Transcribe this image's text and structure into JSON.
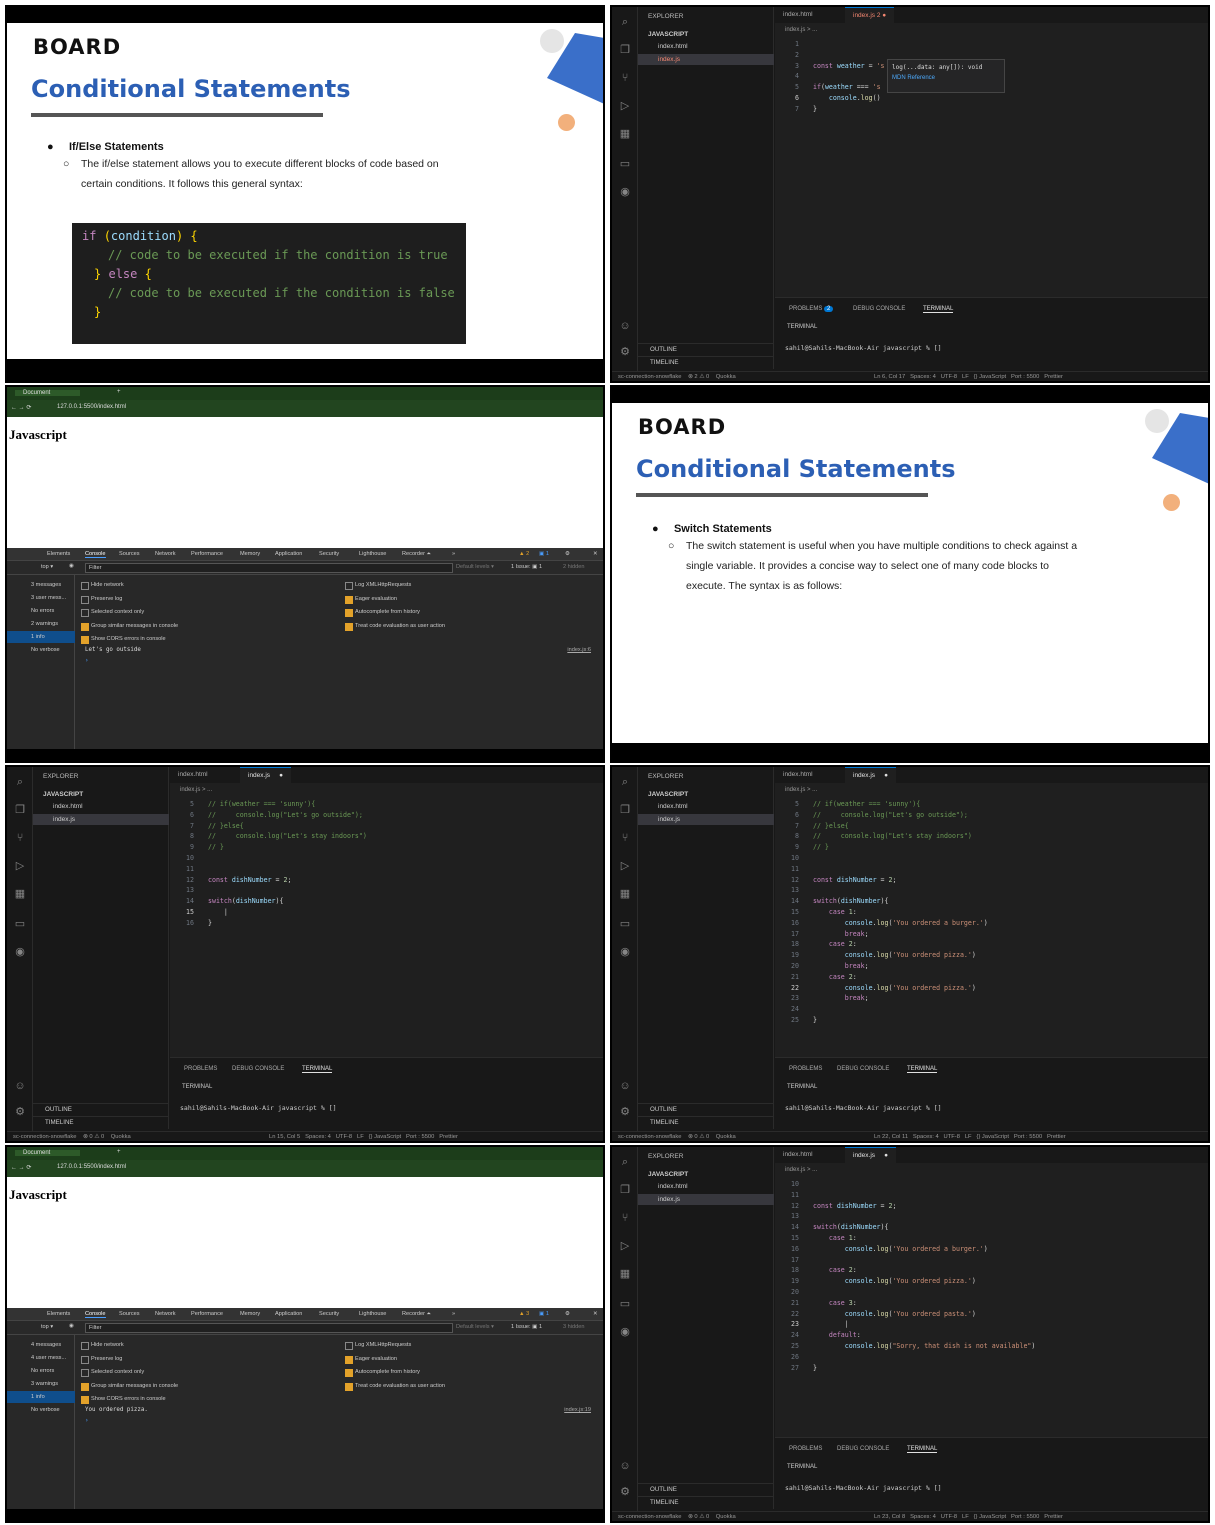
{
  "slide1": {
    "logo": "BOARD",
    "title": "Conditional Statements",
    "bullet": "If/Else Statements",
    "sub": "The if/else statement allows you to execute different blocks of code based on certain conditions. It follows this general syntax:",
    "code": [
      "if (condition) {",
      "    // code to be executed if the condition is true",
      "} else {",
      "    // code to be executed if the condition is false",
      "}"
    ]
  },
  "slide2": {
    "logo": "BOARD",
    "title": "Conditional Statements",
    "bullet": "Switch Statements",
    "sub": "The switch statement is useful when you have multiple conditions to check against a single variable. It provides a concise way to select one of many code blocks to execute. The syntax is as follows:"
  },
  "vs_common": {
    "explorer": "EXPLORER",
    "folder": "JAVASCRIPT",
    "file1": "index.html",
    "file2": "index.js",
    "tab1": "index.html",
    "tab2": "index.js",
    "crumb": "index.js > ...",
    "problems": "PROBLEMS",
    "debug": "DEBUG CONSOLE",
    "terminal": "TERMINAL",
    "terminal_hdr": "TERMINAL",
    "prompt": "sahil@Sahils-MacBook-Air javascript % []",
    "outline": "OUTLINE",
    "timeline": "TIMELINE",
    "branch": "sc-connection-snowflake",
    "quokka": "Quokka",
    "spaces": "Spaces: 4",
    "enc": "UTF-8",
    "eol": "LF",
    "lang": "{} JavaScript",
    "port": "Port : 5500",
    "prettier": "Prettier"
  },
  "vs1": {
    "tab_badge": "2",
    "problem_count": "2",
    "hover_sig": "log(...data: any[]): void",
    "hover_link": "MDN Reference",
    "errors": "⊗ 2 ⚠ 0",
    "cursor": "Ln 6, Col 17",
    "lines": [
      {
        "n": "1",
        "t": ""
      },
      {
        "n": "2",
        "t": ""
      },
      {
        "n": "3",
        "t": "const weather = 's"
      },
      {
        "n": "4",
        "t": ""
      },
      {
        "n": "5",
        "t": "if(weather === 's"
      },
      {
        "n": "6",
        "t": "    console.log()"
      },
      {
        "n": "7",
        "t": "}"
      }
    ]
  },
  "vs2": {
    "errors": "⊗ 0 ⚠ 0",
    "cursor": "Ln 15, Col 5",
    "lines": [
      {
        "n": "5",
        "t": "// if(weather === 'sunny'){"
      },
      {
        "n": "6",
        "t": "//     console.log(\"Let's go outside\");"
      },
      {
        "n": "7",
        "t": "// }else{"
      },
      {
        "n": "8",
        "t": "//     console.log(\"Let's stay indoors\")"
      },
      {
        "n": "9",
        "t": "// }"
      },
      {
        "n": "10",
        "t": ""
      },
      {
        "n": "11",
        "t": ""
      },
      {
        "n": "12",
        "t": "const dishNumber = 2;"
      },
      {
        "n": "13",
        "t": ""
      },
      {
        "n": "14",
        "t": "switch(dishNumber){"
      },
      {
        "n": "15",
        "t": "    |"
      },
      {
        "n": "16",
        "t": "}"
      }
    ]
  },
  "vs3": {
    "errors": "⊗ 0 ⚠ 0",
    "cursor": "Ln 22, Col 11",
    "lines": [
      {
        "n": "5",
        "t": "// if(weather === 'sunny'){"
      },
      {
        "n": "6",
        "t": "//     console.log(\"Let's go outside\");"
      },
      {
        "n": "7",
        "t": "// }else{"
      },
      {
        "n": "8",
        "t": "//     console.log(\"Let's stay indoors\")"
      },
      {
        "n": "9",
        "t": "// }"
      },
      {
        "n": "10",
        "t": ""
      },
      {
        "n": "11",
        "t": ""
      },
      {
        "n": "12",
        "t": "const dishNumber = 2;"
      },
      {
        "n": "13",
        "t": ""
      },
      {
        "n": "14",
        "t": "switch(dishNumber){"
      },
      {
        "n": "15",
        "t": "    case 1:"
      },
      {
        "n": "16",
        "t": "        console.log('You ordered a burger.')"
      },
      {
        "n": "17",
        "t": "        break;"
      },
      {
        "n": "18",
        "t": "    case 2:"
      },
      {
        "n": "19",
        "t": "        console.log('You ordered pizza.')"
      },
      {
        "n": "20",
        "t": "        break;"
      },
      {
        "n": "21",
        "t": "    case 2:"
      },
      {
        "n": "22",
        "t": "        console.log('You ordered pizza.')"
      },
      {
        "n": "23",
        "t": "        break;"
      },
      {
        "n": "24",
        "t": ""
      },
      {
        "n": "25",
        "t": "}"
      }
    ]
  },
  "vs4": {
    "errors": "⊗ 0 ⚠ 0",
    "cursor": "Ln 23, Col 8",
    "lines": [
      {
        "n": "10",
        "t": ""
      },
      {
        "n": "11",
        "t": ""
      },
      {
        "n": "12",
        "t": "const dishNumber = 2;"
      },
      {
        "n": "13",
        "t": ""
      },
      {
        "n": "14",
        "t": "switch(dishNumber){"
      },
      {
        "n": "15",
        "t": "    case 1:"
      },
      {
        "n": "16",
        "t": "        console.log('You ordered a burger.')"
      },
      {
        "n": "17",
        "t": ""
      },
      {
        "n": "18",
        "t": "    case 2:"
      },
      {
        "n": "19",
        "t": "        console.log('You ordered pizza.')"
      },
      {
        "n": "20",
        "t": ""
      },
      {
        "n": "21",
        "t": "    case 3:"
      },
      {
        "n": "22",
        "t": "        console.log('You ordered pasta.')"
      },
      {
        "n": "23",
        "t": "        |"
      },
      {
        "n": "24",
        "t": "    default:"
      },
      {
        "n": "25",
        "t": "        console.log(\"Sorry, that dish is not available\")"
      },
      {
        "n": "26",
        "t": ""
      },
      {
        "n": "27",
        "t": "}"
      }
    ]
  },
  "browser_common": {
    "tab": "Document",
    "url": "127.0.0.1:5500/index.html",
    "heading": "Javascript",
    "devtabs": [
      "Elements",
      "Console",
      "Sources",
      "Network",
      "Performance",
      "Memory",
      "Application",
      "Security",
      "Lighthouse",
      "Recorder ⏶",
      "»"
    ],
    "top": "top ▾",
    "filter": "Filter",
    "levels": "Default levels ▾",
    "issue": "1 Issue: ▣ 1",
    "errors": "No errors",
    "verbose": "No verbose",
    "options_left": [
      "Hide network",
      "Preserve log",
      "Selected context only",
      "Group similar messages in console",
      "Show CORS errors in console"
    ],
    "options_right": [
      "Log XMLHttpRequests",
      "Eager evaluation",
      "Autocomplete from history",
      "Treat code evaluation as user action"
    ],
    "prompt": "›"
  },
  "browser1": {
    "messages": "3 messages",
    "user": "3 user mess...",
    "warnings": "2 warnings",
    "info": "1 info",
    "hidden": "2 hidden",
    "warn_badge": "▲ 2",
    "info_badge": "▣ 1",
    "log": "Let's go outside",
    "source": "index.js:6"
  },
  "browser2": {
    "messages": "4 messages",
    "user": "4 user mess...",
    "warnings": "3 warnings",
    "info": "1 info",
    "hidden": "3 hidden",
    "warn_badge": "▲ 3",
    "info_badge": "▣ 1",
    "log": "You ordered pizza.",
    "source": "index.js:19"
  }
}
